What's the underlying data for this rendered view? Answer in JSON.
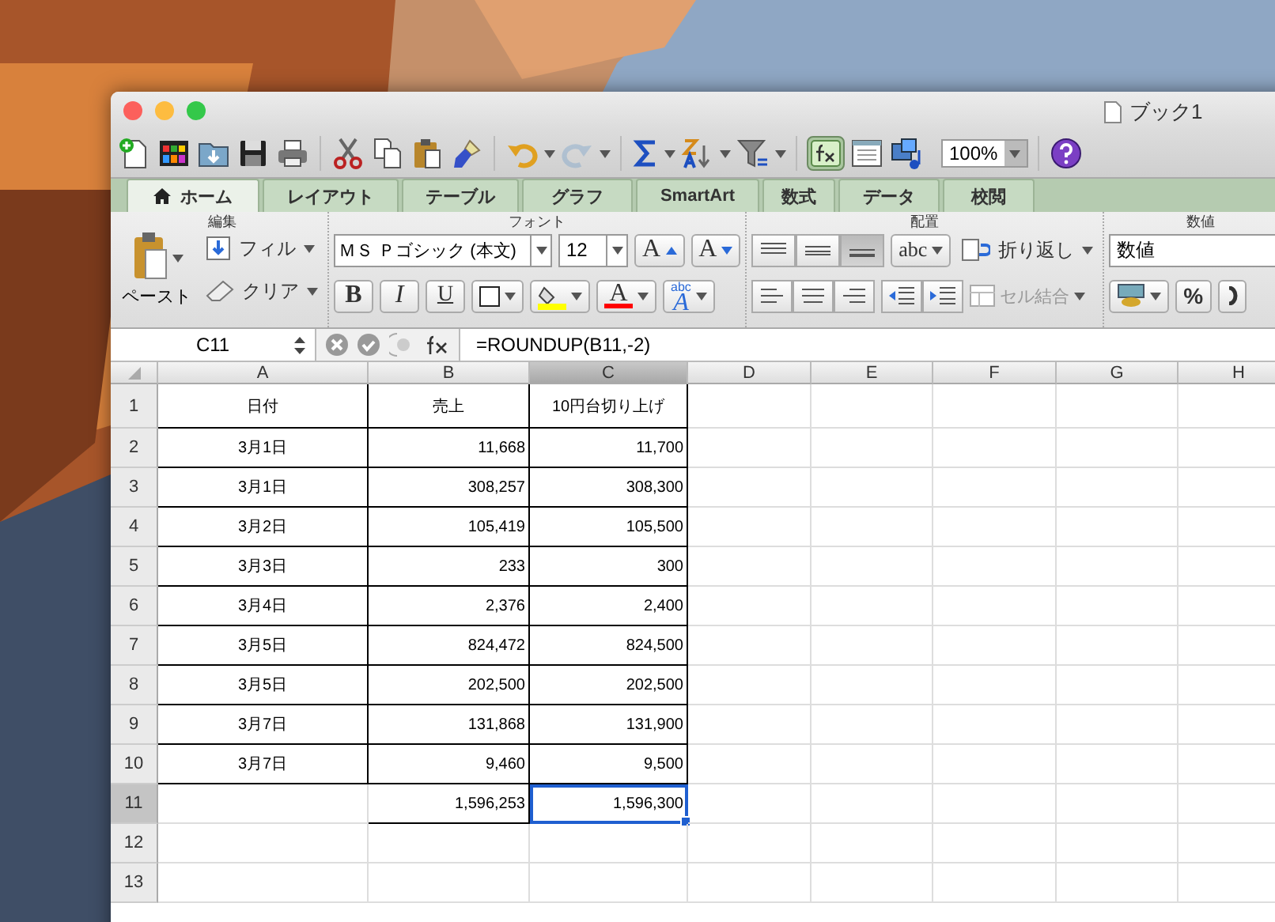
{
  "window": {
    "title": "ブック1"
  },
  "toolbar": {
    "redo_disabled": true,
    "formula_builder_on": true,
    "zoom": "100%"
  },
  "tabs": [
    {
      "label": "ホーム",
      "selected": true
    },
    {
      "label": "レイアウト",
      "selected": false
    },
    {
      "label": "テーブル",
      "selected": false
    },
    {
      "label": "グラフ",
      "selected": false
    },
    {
      "label": "SmartArt",
      "selected": false
    },
    {
      "label": "数式",
      "selected": false
    },
    {
      "label": "データ",
      "selected": false
    },
    {
      "label": "校閲",
      "selected": false
    }
  ],
  "ribbon": {
    "edit": {
      "title": "編集",
      "paste": "ペースト",
      "fill": "フィル",
      "clear": "クリア"
    },
    "font": {
      "title": "フォント",
      "font_name": "ＭＳ Ｐゴシック (本文)",
      "font_size": "12",
      "grow": "A",
      "shrink": "A",
      "bold": "B",
      "italic": "I",
      "underline": "U",
      "font_color_letter": "A",
      "styles_top": "abc",
      "styles_letter": "A"
    },
    "alignment": {
      "title": "配置",
      "vertical_align": [
        {
          "selected": false
        },
        {
          "selected": false
        },
        {
          "selected": true
        }
      ],
      "orientation": "abc",
      "wrap": "折り返し",
      "merge": {
        "label": "セル結合",
        "disabled": true
      }
    },
    "number": {
      "title": "数値",
      "format": "数値",
      "percent": "%"
    }
  },
  "formula_bar": {
    "name_box": "C11",
    "formula": "=ROUNDUP(B11,-2)"
  },
  "sheet": {
    "columns": [
      {
        "label": "A",
        "selected": false
      },
      {
        "label": "B",
        "selected": false
      },
      {
        "label": "C",
        "selected": true
      },
      {
        "label": "D",
        "selected": false
      },
      {
        "label": "E",
        "selected": false
      },
      {
        "label": "F",
        "selected": false
      },
      {
        "label": "G",
        "selected": false
      },
      {
        "label": "H",
        "selected": false
      }
    ],
    "rows": [
      {
        "number": "1",
        "selected": false,
        "cells": [
          {
            "text": "日付",
            "bordered": true,
            "selected": false
          },
          {
            "text": "売上",
            "bordered": true,
            "selected": false
          },
          {
            "text": "10円台切り上げ",
            "bordered": true,
            "selected": false
          }
        ]
      },
      {
        "number": "2",
        "selected": false,
        "cells": [
          {
            "text": "3月1日",
            "bordered": true,
            "selected": false
          },
          {
            "text": "11,668",
            "bordered": true,
            "selected": false
          },
          {
            "text": "11,700",
            "bordered": true,
            "selected": false
          }
        ]
      },
      {
        "number": "3",
        "selected": false,
        "cells": [
          {
            "text": "3月1日",
            "bordered": true,
            "selected": false
          },
          {
            "text": "308,257",
            "bordered": true,
            "selected": false
          },
          {
            "text": "308,300",
            "bordered": true,
            "selected": false
          }
        ]
      },
      {
        "number": "4",
        "selected": false,
        "cells": [
          {
            "text": "3月2日",
            "bordered": true,
            "selected": false
          },
          {
            "text": "105,419",
            "bordered": true,
            "selected": false
          },
          {
            "text": "105,500",
            "bordered": true,
            "selected": false
          }
        ]
      },
      {
        "number": "5",
        "selected": false,
        "cells": [
          {
            "text": "3月3日",
            "bordered": true,
            "selected": false
          },
          {
            "text": "233",
            "bordered": true,
            "selected": false
          },
          {
            "text": "300",
            "bordered": true,
            "selected": false
          }
        ]
      },
      {
        "number": "6",
        "selected": false,
        "cells": [
          {
            "text": "3月4日",
            "bordered": true,
            "selected": false
          },
          {
            "text": "2,376",
            "bordered": true,
            "selected": false
          },
          {
            "text": "2,400",
            "bordered": true,
            "selected": false
          }
        ]
      },
      {
        "number": "7",
        "selected": false,
        "cells": [
          {
            "text": "3月5日",
            "bordered": true,
            "selected": false
          },
          {
            "text": "824,472",
            "bordered": true,
            "selected": false
          },
          {
            "text": "824,500",
            "bordered": true,
            "selected": false
          }
        ]
      },
      {
        "number": "8",
        "selected": false,
        "cells": [
          {
            "text": "3月5日",
            "bordered": true,
            "selected": false
          },
          {
            "text": "202,500",
            "bordered": true,
            "selected": false
          },
          {
            "text": "202,500",
            "bordered": true,
            "selected": false
          }
        ]
      },
      {
        "number": "9",
        "selected": false,
        "cells": [
          {
            "text": "3月7日",
            "bordered": true,
            "selected": false
          },
          {
            "text": "131,868",
            "bordered": true,
            "selected": false
          },
          {
            "text": "131,900",
            "bordered": true,
            "selected": false
          }
        ]
      },
      {
        "number": "10",
        "selected": false,
        "cells": [
          {
            "text": "3月7日",
            "bordered": true,
            "selected": false
          },
          {
            "text": "9,460",
            "bordered": true,
            "selected": false
          },
          {
            "text": "9,500",
            "bordered": true,
            "selected": false
          }
        ]
      },
      {
        "number": "11",
        "selected": true,
        "cells": [
          {
            "bordered": false,
            "selected": false
          },
          {
            "text": "1,596,253",
            "bordered": true,
            "selected": false
          },
          {
            "text": "1,596,300",
            "bordered": true,
            "selected": true
          }
        ]
      },
      {
        "number": "12",
        "selected": false,
        "cells": []
      },
      {
        "number": "13",
        "selected": false,
        "cells": []
      }
    ]
  }
}
